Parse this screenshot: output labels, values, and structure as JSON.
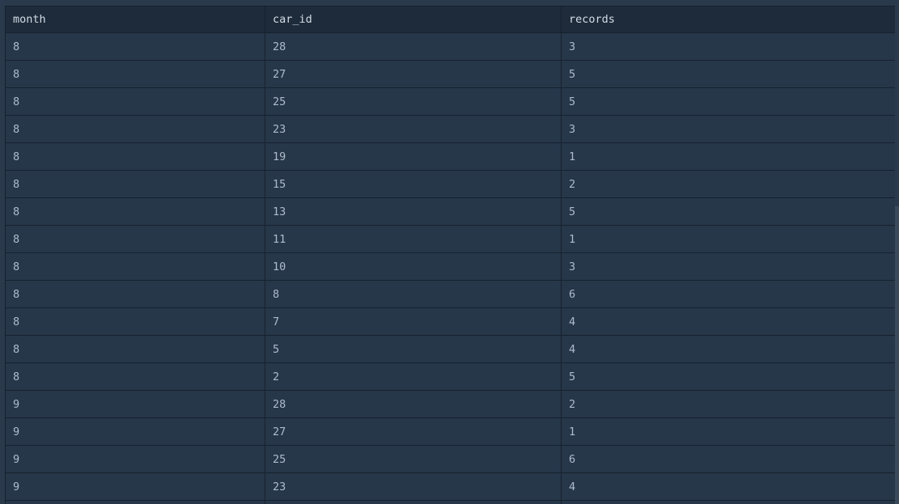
{
  "table": {
    "columns": [
      "month",
      "car_id",
      "records"
    ],
    "rows": [
      [
        "8",
        "28",
        "3"
      ],
      [
        "8",
        "27",
        "5"
      ],
      [
        "8",
        "25",
        "5"
      ],
      [
        "8",
        "23",
        "3"
      ],
      [
        "8",
        "19",
        "1"
      ],
      [
        "8",
        "15",
        "2"
      ],
      [
        "8",
        "13",
        "5"
      ],
      [
        "8",
        "11",
        "1"
      ],
      [
        "8",
        "10",
        "3"
      ],
      [
        "8",
        "8",
        "6"
      ],
      [
        "8",
        "7",
        "4"
      ],
      [
        "8",
        "5",
        "4"
      ],
      [
        "8",
        "2",
        "5"
      ],
      [
        "9",
        "28",
        "2"
      ],
      [
        "9",
        "27",
        "1"
      ],
      [
        "9",
        "25",
        "6"
      ],
      [
        "9",
        "23",
        "4"
      ],
      [
        "",
        "",
        ""
      ]
    ]
  },
  "colors": {
    "background": "#2a3a4c",
    "header_bg": "#1e2b3b",
    "row_bg": "#26374a",
    "border": "#16212d",
    "text": "#aebccb",
    "header_text": "#d4dde6"
  }
}
